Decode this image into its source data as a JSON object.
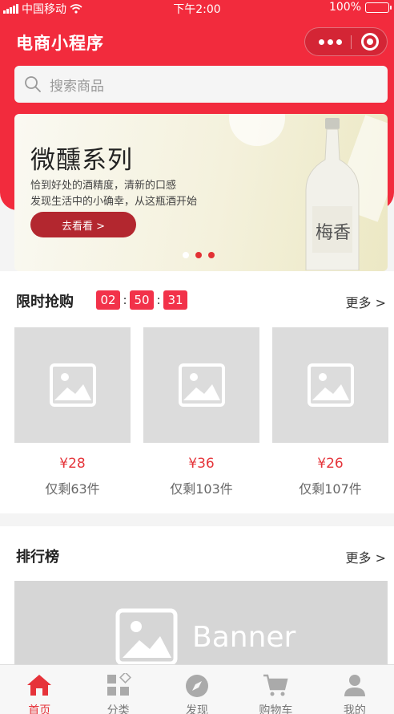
{
  "status_bar": {
    "carrier": "中国移动",
    "time": "下午2:00",
    "battery": "100%"
  },
  "navbar": {
    "title": "电商小程序",
    "more_icon": "more-dots-icon",
    "close_icon": "target-circle-icon"
  },
  "search": {
    "placeholder": "搜索商品",
    "icon": "search-icon"
  },
  "banner": {
    "title": "微醺系列",
    "subtitle_line1": "恰到好处的酒精度，清新的口感",
    "subtitle_line2": "发现生活中的小确幸，从这瓶酒开始",
    "button_label": "去看看 >",
    "bottle_label": "梅香",
    "slide_count": 3,
    "active_slide": 2
  },
  "flash_sale": {
    "title": "限时抢购",
    "countdown": {
      "hours": "02",
      "minutes": "50",
      "seconds": "31",
      "separator": ":"
    },
    "more_label": "更多 >",
    "products": [
      {
        "price": "¥28",
        "stock": "仅剩63件"
      },
      {
        "price": "¥36",
        "stock": "仅剩103件"
      },
      {
        "price": "¥26",
        "stock": "仅剩107件"
      }
    ]
  },
  "ranking": {
    "title": "排行榜",
    "more_label": "更多 >",
    "banner_text": "Banner"
  },
  "tabbar": {
    "items": [
      {
        "label": "首页",
        "icon": "home-icon",
        "active": true
      },
      {
        "label": "分类",
        "icon": "category-icon",
        "active": false
      },
      {
        "label": "发现",
        "icon": "compass-icon",
        "active": false
      },
      {
        "label": "购物车",
        "icon": "cart-icon",
        "active": false
      },
      {
        "label": "我的",
        "icon": "user-icon",
        "active": false
      }
    ]
  },
  "colors": {
    "brand_red": "#f22b3d",
    "price_red": "#e5353b",
    "banner_button": "#b3272f",
    "placeholder_gray": "#dcdcdc"
  }
}
